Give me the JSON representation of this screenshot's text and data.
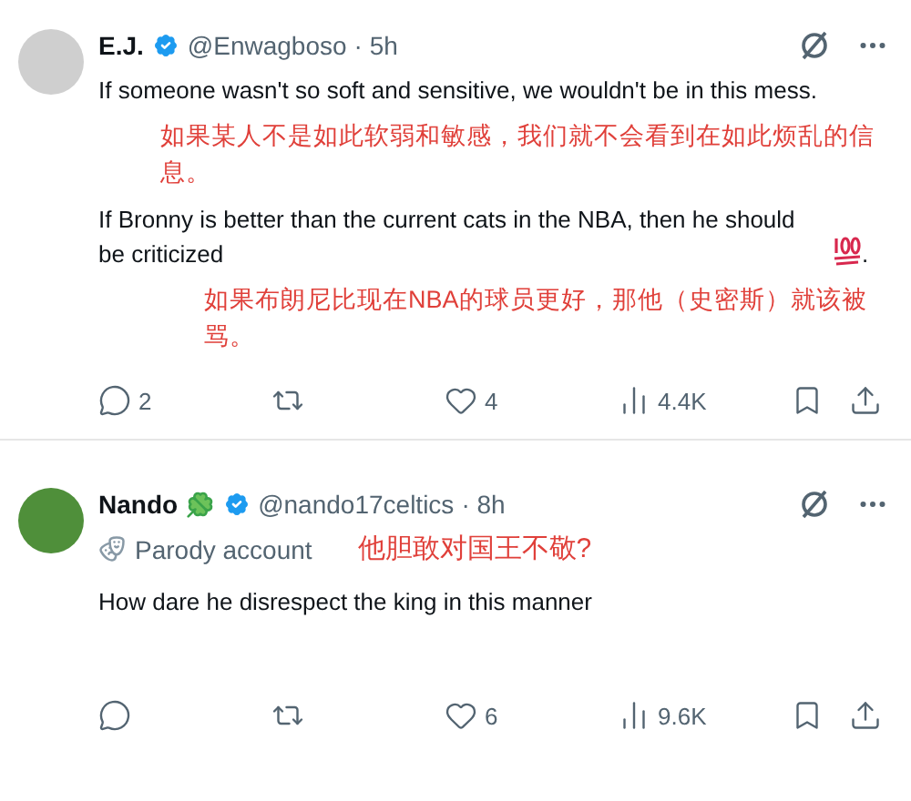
{
  "tweets": [
    {
      "name": "E.J.",
      "verified": true,
      "clover": false,
      "handle": "@Enwagboso",
      "time": "· 5h",
      "body": [
        {
          "kind": "text",
          "text": "If someone wasn't so soft and sensitive, we wouldn't be in this mess.",
          "hundred_icon": false
        },
        {
          "kind": "annotation",
          "text": "如果某人不是如此软弱和敏感，我们就不会看到在如此烦乱的信息。"
        },
        {
          "kind": "text",
          "text": "If Bronny is better than the current cats in the NBA, then he should be criticized",
          "hundred_icon": true,
          "suffix": "."
        },
        {
          "kind": "annotation",
          "text": "如果布朗尼比现在NBA的球员更好，那他（史密斯）就该被骂。"
        }
      ],
      "actions": [
        {
          "kind": "reply",
          "count": "2"
        },
        {
          "kind": "repost"
        },
        {
          "kind": "like",
          "count": "4"
        },
        {
          "kind": "views",
          "count": "4.4K"
        },
        {
          "kind": "bookmark"
        },
        {
          "kind": "share"
        }
      ]
    },
    {
      "name": "Nando",
      "verified": true,
      "clover": true,
      "handle": "@nando17celtics",
      "time": "· 8h",
      "parody_label": "Parody account",
      "parody_note": "他胆敢对国王不敬?",
      "body": [
        {
          "kind": "text",
          "text": "How dare he disrespect the king in this manner",
          "hundred_icon": false
        }
      ],
      "actions": [
        {
          "kind": "reply"
        },
        {
          "kind": "repost"
        },
        {
          "kind": "like",
          "count": "6"
        },
        {
          "kind": "views",
          "count": "9.6K"
        },
        {
          "kind": "bookmark"
        },
        {
          "kind": "share"
        }
      ]
    }
  ]
}
